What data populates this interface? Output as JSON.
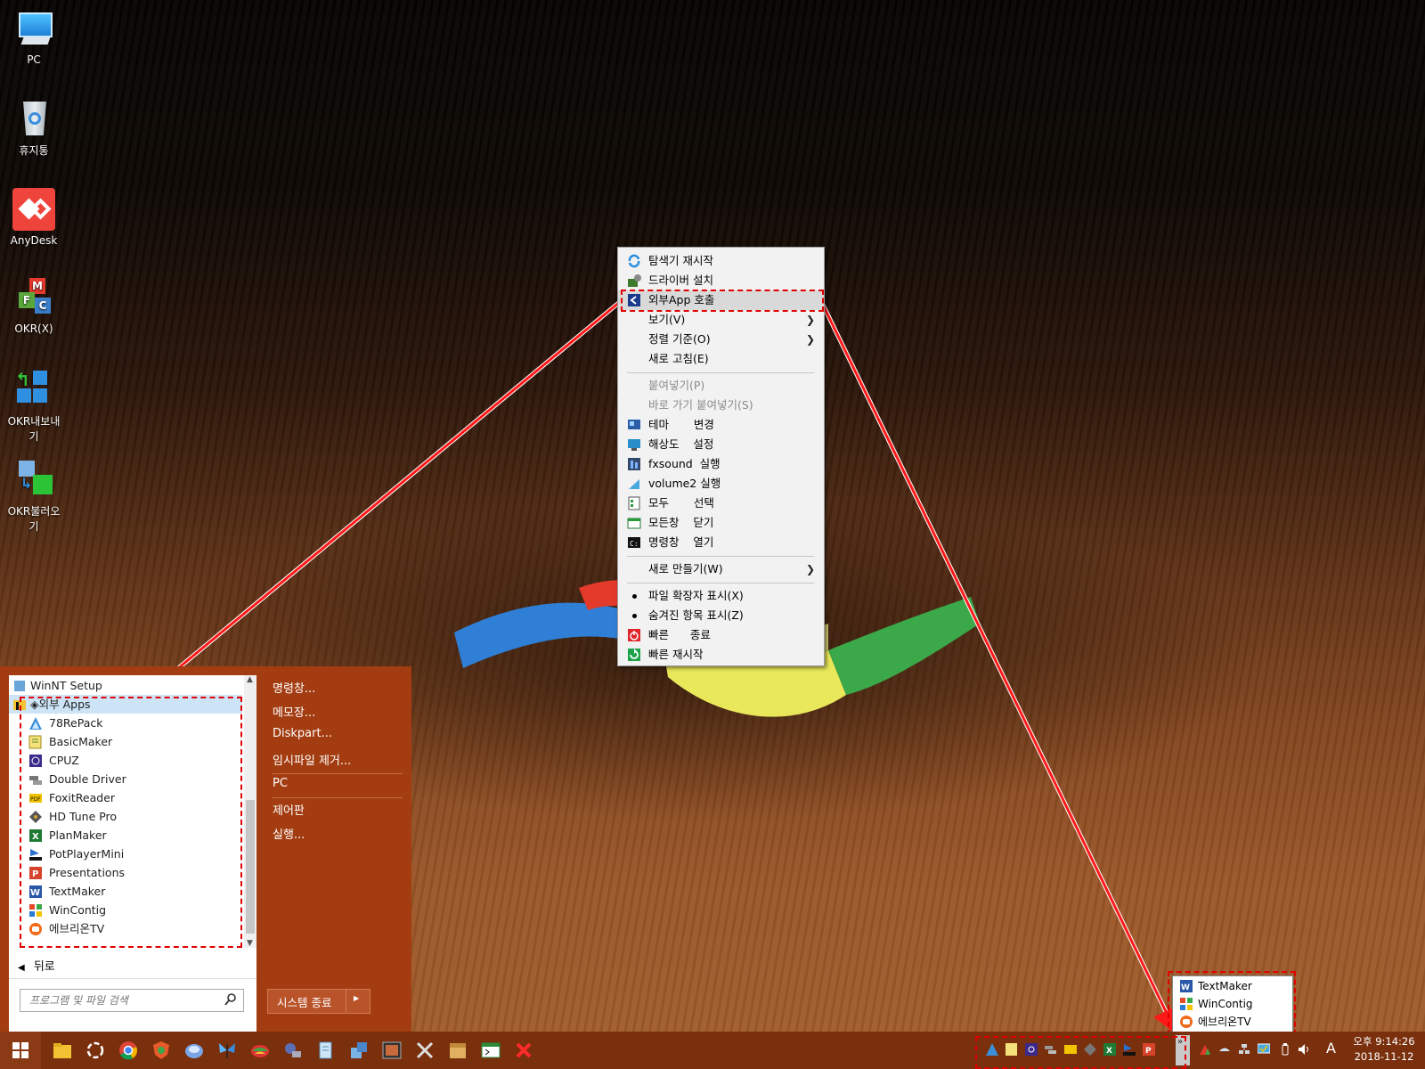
{
  "desktop": {
    "icons": [
      {
        "label": "PC",
        "icon": "computer-icon"
      },
      {
        "label": "휴지통",
        "icon": "recycle-bin-icon"
      },
      {
        "label": "AnyDesk",
        "icon": "anydesk-icon"
      },
      {
        "label": "OKR(X)",
        "icon": "okr-icon"
      },
      {
        "label": "OKR내보내기",
        "icon": "okr-export-icon"
      },
      {
        "label": "OKR불러오기",
        "icon": "okr-import-icon"
      }
    ]
  },
  "context_menu": {
    "items": [
      {
        "label": "탐색기 재시작",
        "icon": "refresh-icon"
      },
      {
        "label": "드라이버 설치",
        "icon": "driver-icon"
      },
      {
        "label": "외부App 호출",
        "icon": "external-app-icon"
      },
      {
        "label": "보기(V)"
      },
      {
        "label": "정렬 기준(O)"
      },
      {
        "label": "새로 고침(E)"
      },
      {
        "label": "붙여넣기(P)"
      },
      {
        "label": "바로 가기 붙여넣기(S)"
      },
      {
        "label": "테마       변경",
        "icon": "theme-icon"
      },
      {
        "label": "해상도    설정",
        "icon": "resolution-icon"
      },
      {
        "label": "fxsound  실행",
        "icon": "fxsound-icon"
      },
      {
        "label": "volume2 실행",
        "icon": "volume2-icon"
      },
      {
        "label": "모두       선택",
        "icon": "select-all-icon"
      },
      {
        "label": "모든창    닫기",
        "icon": "close-windows-icon"
      },
      {
        "label": "명령창    열기",
        "icon": "cmd-icon"
      },
      {
        "label": "새로 만들기(W)"
      },
      {
        "label": "파일 확장자 표시(X)"
      },
      {
        "label": "숨겨진 항목 표시(Z)"
      },
      {
        "label": "빠른      종료",
        "icon": "power-icon"
      },
      {
        "label": "빠른 재시작",
        "icon": "restart-icon"
      }
    ]
  },
  "start_menu": {
    "programs": [
      {
        "label": "WinNT Setup",
        "icon": "winnt-setup-icon"
      },
      {
        "label": "◈외부 Apps",
        "icon": "folder-icon"
      },
      {
        "label": "78RePack",
        "icon": "78repack-icon"
      },
      {
        "label": "BasicMaker",
        "icon": "basicmaker-icon"
      },
      {
        "label": "CPUZ",
        "icon": "cpuz-icon"
      },
      {
        "label": "Double Driver",
        "icon": "double-driver-icon"
      },
      {
        "label": "FoxitReader",
        "icon": "foxit-icon"
      },
      {
        "label": "HD Tune Pro",
        "icon": "hdtune-icon"
      },
      {
        "label": "PlanMaker",
        "icon": "planmaker-icon"
      },
      {
        "label": "PotPlayerMini",
        "icon": "potplayer-icon"
      },
      {
        "label": "Presentations",
        "icon": "presentations-icon"
      },
      {
        "label": "TextMaker",
        "icon": "textmaker-icon"
      },
      {
        "label": "WinContig",
        "icon": "wincontig-icon"
      },
      {
        "label": "에브리온TV",
        "icon": "everyontv-icon"
      }
    ],
    "back_label": "뒤로",
    "search_placeholder": "프로그램 및 파일 검색",
    "right_items": [
      "명령창...",
      "메모장...",
      "Diskpart...",
      "임시파일 제거...",
      "PC",
      "제어판",
      "실행..."
    ],
    "shutdown_label": "시스템 종료"
  },
  "tray_popup": {
    "items": [
      {
        "label": "TextMaker",
        "icon": "textmaker-icon"
      },
      {
        "label": "WinContig",
        "icon": "wincontig-icon"
      },
      {
        "label": "에브리온TV",
        "icon": "everyontv-icon"
      }
    ]
  },
  "taskbar": {
    "clock_time": "오후 9:14:26",
    "clock_date": "2018-11-12",
    "ime_label": "A",
    "overflow_label": "»"
  }
}
